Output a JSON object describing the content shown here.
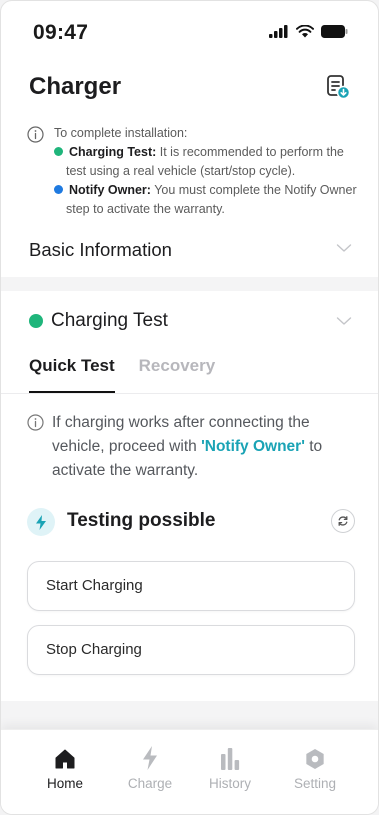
{
  "status_bar": {
    "time": "09:47"
  },
  "header": {
    "title": "Charger"
  },
  "install_note": {
    "intro": "To complete installation:",
    "items": [
      {
        "bold": "Charging Test:",
        "text": " It is recommended to perform the test using a real vehicle (start/stop cycle).",
        "color": "#1fb57b"
      },
      {
        "bold": "Notify Owner:",
        "text": " You must complete the Notify Owner step to activate the warranty.",
        "color": "#1f7ae0"
      }
    ]
  },
  "basic_info": {
    "label": "Basic Information"
  },
  "charging_test": {
    "label": "Charging Test",
    "tabs": [
      {
        "label": "Quick Test",
        "active": true
      },
      {
        "label": "Recovery",
        "active": false
      }
    ],
    "note_before": "If charging works after connecting the vehicle, proceed with ",
    "note_link": "'Notify Owner'",
    "note_after": " to activate the warranty.",
    "testing_status": "Testing possible",
    "start_button": "Start Charging",
    "stop_button": "Stop Charging"
  },
  "bottom_nav": {
    "items": [
      {
        "label": "Home",
        "icon": "home-icon",
        "active": true
      },
      {
        "label": "Charge",
        "icon": "bolt-icon",
        "active": false
      },
      {
        "label": "History",
        "icon": "bar-chart-icon",
        "active": false
      },
      {
        "label": "Setting",
        "icon": "gear-icon",
        "active": false
      }
    ]
  },
  "colors": {
    "accent": "#1aa3b5",
    "success": "#1fb57b",
    "info": "#1f7ae0"
  }
}
